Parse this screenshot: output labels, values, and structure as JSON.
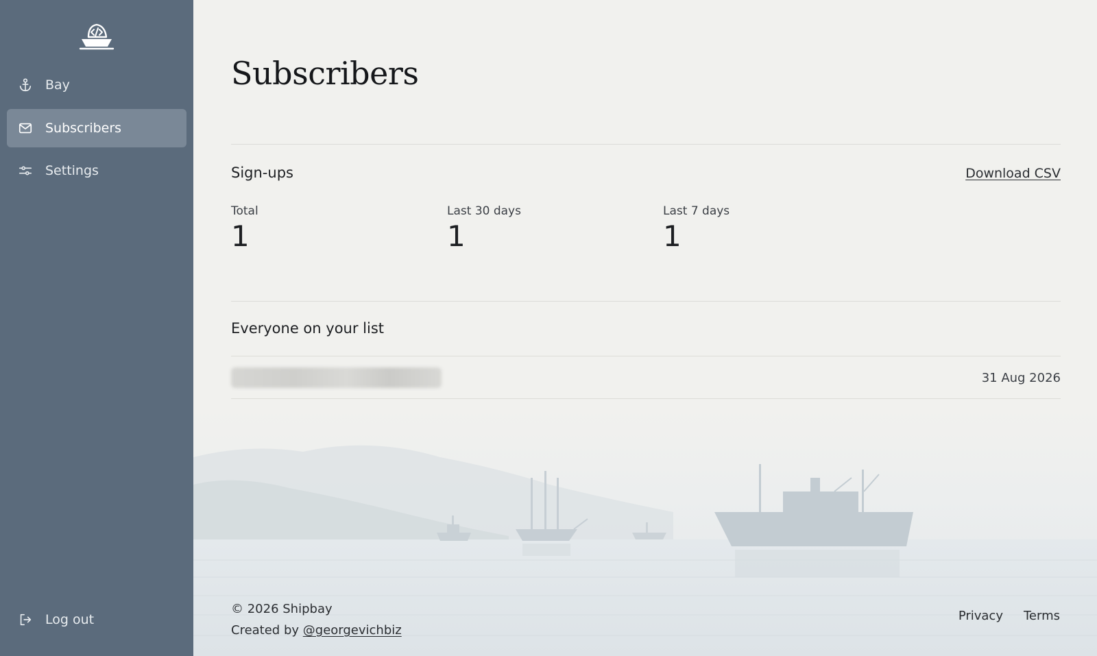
{
  "sidebar": {
    "logo_icon": "ship-code-logo",
    "items": [
      {
        "label": "Bay",
        "icon": "anchor-icon",
        "active": false
      },
      {
        "label": "Subscribers",
        "icon": "mail-icon",
        "active": true
      },
      {
        "label": "Settings",
        "icon": "sliders-icon",
        "active": false
      }
    ],
    "logout": {
      "label": "Log out",
      "icon": "logout-icon"
    }
  },
  "main": {
    "title": "Subscribers",
    "signups": {
      "heading": "Sign-ups",
      "download_label": "Download CSV",
      "stats": [
        {
          "label": "Total",
          "value": "1"
        },
        {
          "label": "Last 30 days",
          "value": "1"
        },
        {
          "label": "Last 7 days",
          "value": "1"
        }
      ]
    },
    "list": {
      "heading": "Everyone on your list",
      "rows": [
        {
          "date": "31 Aug 2026"
        }
      ]
    }
  },
  "footer": {
    "copyright": "© 2026 Shipbay",
    "created_by_prefix": "Created by ",
    "created_by_handle": "@georgevichbiz",
    "links": [
      "Privacy",
      "Terms"
    ]
  },
  "colors": {
    "sidebar_bg": "#5b6b7c",
    "sidebar_active": "#7a8897",
    "main_bg": "#f1f1ee"
  }
}
